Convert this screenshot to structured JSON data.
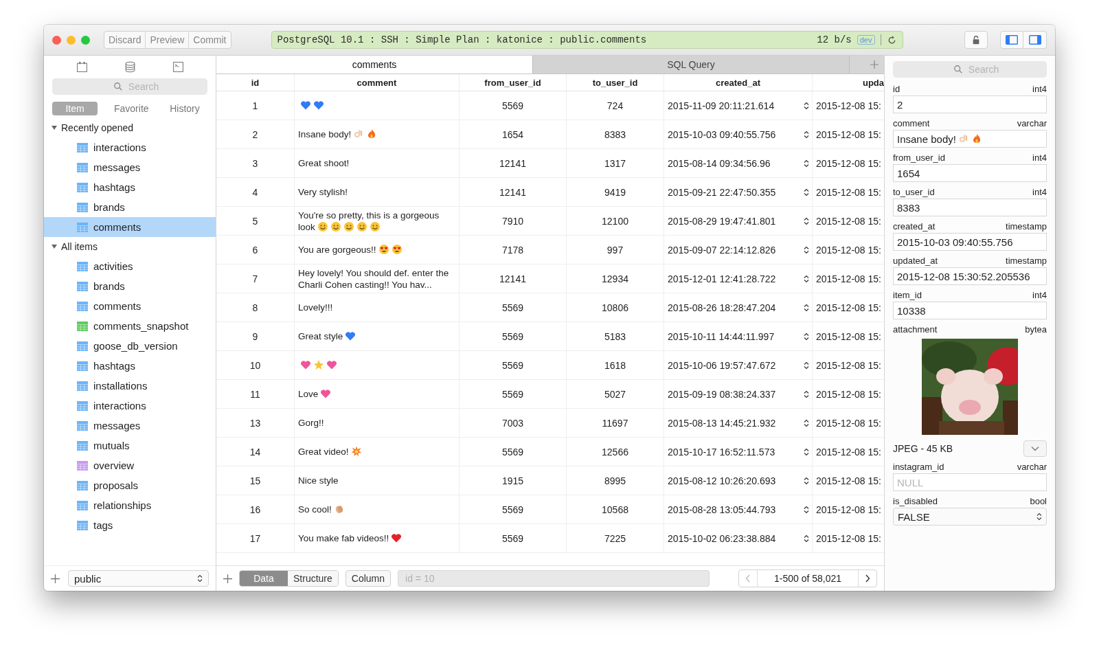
{
  "toolbar": {
    "buttons": [
      "Discard",
      "Preview",
      "Commit"
    ],
    "connection": "PostgreSQL 10.1 : SSH : Simple Plan : katonice : public.comments",
    "rate": "12 b/s",
    "env_badge": "dev",
    "panel_toggles": [
      {
        "selected": true
      },
      {
        "selected": true
      }
    ]
  },
  "sidebar": {
    "search": {
      "placeholder": "Search"
    },
    "segments": [
      {
        "label": "Item",
        "selected": true
      },
      {
        "label": "Favorite",
        "selected": false
      },
      {
        "label": "History",
        "selected": false
      }
    ],
    "sections": [
      {
        "title": "Recently opened",
        "expanded": true,
        "children": [
          {
            "name": "interactions",
            "color": "#6cb4f8",
            "selected": false
          },
          {
            "name": "messages",
            "color": "#6cb4f8",
            "selected": false
          },
          {
            "name": "hashtags",
            "color": "#6cb4f8",
            "selected": false
          },
          {
            "name": "brands",
            "color": "#6cb4f8",
            "selected": false
          },
          {
            "name": "comments",
            "color": "#6cb4f8",
            "selected": true
          }
        ]
      },
      {
        "title": "All items",
        "expanded": true,
        "children": [
          {
            "name": "activities",
            "color": "#6cb4f8",
            "selected": false
          },
          {
            "name": "brands",
            "color": "#6cb4f8",
            "selected": false
          },
          {
            "name": "comments",
            "color": "#6cb4f8",
            "selected": false
          },
          {
            "name": "comments_snapshot",
            "color": "#5ccd5c",
            "selected": false
          },
          {
            "name": "goose_db_version",
            "color": "#6cb4f8",
            "selected": false
          },
          {
            "name": "hashtags",
            "color": "#6cb4f8",
            "selected": false
          },
          {
            "name": "installations",
            "color": "#6cb4f8",
            "selected": false
          },
          {
            "name": "interactions",
            "color": "#6cb4f8",
            "selected": false
          },
          {
            "name": "messages",
            "color": "#6cb4f8",
            "selected": false
          },
          {
            "name": "mutuals",
            "color": "#6cb4f8",
            "selected": false
          },
          {
            "name": "overview",
            "color": "#c99af0",
            "selected": false
          },
          {
            "name": "proposals",
            "color": "#6cb4f8",
            "selected": false
          },
          {
            "name": "relationships",
            "color": "#6cb4f8",
            "selected": false
          },
          {
            "name": "tags",
            "color": "#6cb4f8",
            "selected": false
          }
        ]
      }
    ],
    "schema": "public"
  },
  "tabs": [
    {
      "label": "comments",
      "selected": true
    },
    {
      "label": "SQL Query",
      "selected": false
    }
  ],
  "table": {
    "columns": [
      "id",
      "comment",
      "from_user_id",
      "to_user_id",
      "created_at",
      "upda"
    ],
    "rows": [
      {
        "id": "1",
        "emojis": [
          {
            "kind": "heart",
            "color": "#2f7cf6"
          },
          {
            "kind": "heart",
            "color": "#2f7cf6"
          }
        ],
        "from_user_id": "5569",
        "to_user_id": "724",
        "created_at": "2015-11-09 20:11:21.614",
        "updated_at": "2015-12-08 15:"
      },
      {
        "id": "2",
        "comment": "Insane body!",
        "emojis": [
          {
            "kind": "ok-hand"
          },
          {
            "kind": "fire"
          }
        ],
        "from_user_id": "1654",
        "to_user_id": "8383",
        "created_at": "2015-10-03 09:40:55.756",
        "updated_at": "2015-12-08 15:"
      },
      {
        "id": "3",
        "comment": "Great shoot!",
        "from_user_id": "12141",
        "to_user_id": "1317",
        "created_at": "2015-08-14 09:34:56.96",
        "updated_at": "2015-12-08 15:"
      },
      {
        "id": "4",
        "comment": "Very stylish!",
        "from_user_id": "12141",
        "to_user_id": "9419",
        "created_at": "2015-09-21 22:47:50.355",
        "updated_at": "2015-12-08 15:"
      },
      {
        "id": "5",
        "comment": "You're so pretty, this is a gorgeous look",
        "emojis": [
          {
            "kind": "smile"
          },
          {
            "kind": "smile"
          },
          {
            "kind": "smile"
          },
          {
            "kind": "smile"
          },
          {
            "kind": "smile"
          }
        ],
        "from_user_id": "7910",
        "to_user_id": "12100",
        "created_at": "2015-08-29 19:47:41.801",
        "updated_at": "2015-12-08 15:"
      },
      {
        "id": "6",
        "comment": "You are gorgeous!!",
        "emojis": [
          {
            "kind": "heart-eyes"
          },
          {
            "kind": "heart-eyes"
          }
        ],
        "from_user_id": "7178",
        "to_user_id": "997",
        "created_at": "2015-09-07 22:14:12.826",
        "updated_at": "2015-12-08 15:"
      },
      {
        "id": "7",
        "comment": "Hey lovely! You should def. enter the Charli Cohen casting!! You hav...",
        "from_user_id": "12141",
        "to_user_id": "12934",
        "created_at": "2015-12-01 12:41:28.722",
        "updated_at": "2015-12-08 15:"
      },
      {
        "id": "8",
        "comment": "Lovely!!!",
        "from_user_id": "5569",
        "to_user_id": "10806",
        "created_at": "2015-08-26 18:28:47.204",
        "updated_at": "2015-12-08 15:"
      },
      {
        "id": "9",
        "comment": "Great style",
        "emojis": [
          {
            "kind": "heart",
            "color": "#2f7cf6"
          }
        ],
        "from_user_id": "5569",
        "to_user_id": "5183",
        "created_at": "2015-10-11 14:44:11.997",
        "updated_at": "2015-12-08 15:"
      },
      {
        "id": "10",
        "emojis": [
          {
            "kind": "heart",
            "color": "#f0559a"
          },
          {
            "kind": "star"
          },
          {
            "kind": "heart",
            "color": "#f0559a"
          }
        ],
        "from_user_id": "5569",
        "to_user_id": "1618",
        "created_at": "2015-10-06 19:57:47.672",
        "updated_at": "2015-12-08 15:"
      },
      {
        "id": "11",
        "comment": "Love",
        "emojis": [
          {
            "kind": "heart",
            "color": "#f0559a"
          }
        ],
        "from_user_id": "5569",
        "to_user_id": "5027",
        "created_at": "2015-09-19 08:38:24.337",
        "updated_at": "2015-12-08 15:"
      },
      {
        "id": "13",
        "comment": "Gorg!!",
        "from_user_id": "7003",
        "to_user_id": "11697",
        "created_at": "2015-08-13 14:45:21.932",
        "updated_at": "2015-12-08 15:"
      },
      {
        "id": "14",
        "comment": "Great video!",
        "emojis": [
          {
            "kind": "boom"
          }
        ],
        "from_user_id": "5569",
        "to_user_id": "12566",
        "created_at": "2015-10-17 16:52:11.573",
        "updated_at": "2015-12-08 15:"
      },
      {
        "id": "15",
        "comment": "Nice style",
        "from_user_id": "1915",
        "to_user_id": "8995",
        "created_at": "2015-08-12 10:26:20.693",
        "updated_at": "2015-12-08 15:"
      },
      {
        "id": "16",
        "comment": "So cool!",
        "emojis": [
          {
            "kind": "clap"
          }
        ],
        "from_user_id": "5569",
        "to_user_id": "10568",
        "created_at": "2015-08-28 13:05:44.793",
        "updated_at": "2015-12-08 15:"
      },
      {
        "id": "17",
        "comment": "You make fab videos!!",
        "emojis": [
          {
            "kind": "heart",
            "color": "#e8202a"
          }
        ],
        "from_user_id": "5569",
        "to_user_id": "7225",
        "created_at": "2015-10-02 06:23:38.884",
        "updated_at": "2015-12-08 15:"
      }
    ]
  },
  "bottom_bar": {
    "views": [
      {
        "label": "Data",
        "selected": true
      },
      {
        "label": "Structure",
        "selected": false
      }
    ],
    "column_button": "Column",
    "filter": {
      "placeholder": "id = 10"
    },
    "prev_disabled": true,
    "page": "1-500 of 58,021"
  },
  "detail": {
    "search": {
      "placeholder": "Search"
    },
    "fields": [
      {
        "kind": "text",
        "name": "id",
        "type": "int4",
        "value": "2"
      },
      {
        "kind": "text",
        "name": "comment",
        "type": "varchar",
        "value": "Insane body!",
        "emojis": [
          {
            "kind": "ok-hand"
          },
          {
            "kind": "fire"
          }
        ]
      },
      {
        "kind": "text",
        "name": "from_user_id",
        "type": "int4",
        "value": "1654"
      },
      {
        "kind": "text",
        "name": "to_user_id",
        "type": "int4",
        "value": "8383"
      },
      {
        "kind": "text",
        "name": "created_at",
        "type": "timestamp",
        "value": "2015-10-03 09:40:55.756"
      },
      {
        "kind": "text",
        "name": "updated_at",
        "type": "timestamp",
        "value": "2015-12-08 15:30:52.205536"
      },
      {
        "kind": "text",
        "name": "item_id",
        "type": "int4",
        "value": "10338"
      },
      {
        "name": "attachment",
        "type": "bytea",
        "caption": "JPEG - 45 KB"
      },
      {
        "kind": "text",
        "name": "instagram_id",
        "type": "varchar",
        "placeholder": "NULL"
      },
      {
        "kind": "select",
        "name": "is_disabled",
        "type": "bool",
        "value": "FALSE"
      }
    ]
  }
}
